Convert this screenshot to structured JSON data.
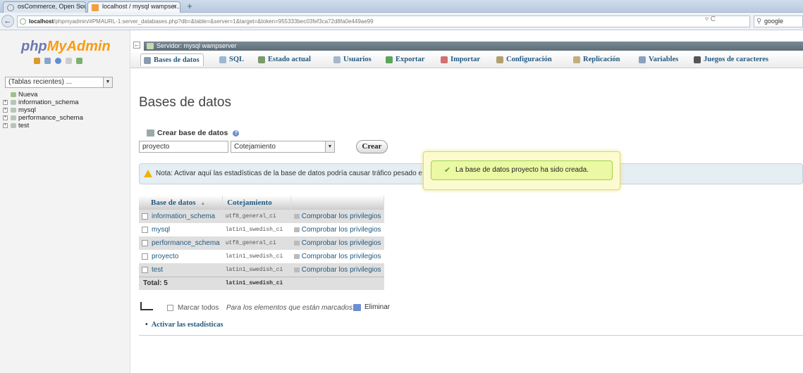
{
  "browser": {
    "tabs": [
      {
        "label": "osCommerce, Open Sourc...",
        "active": false
      },
      {
        "label": "localhost / mysql wampser...",
        "active": true
      }
    ],
    "tab_close": "×",
    "new_tab": "+",
    "url_host": "localhost",
    "url_path": "/phpmyadmin/#PMAURL-1:server_databases.php?db=&table=&server=1&target=&token=955333bec03fef3ca72d8fa0e449ae99",
    "reload": "▿ C",
    "search": "google",
    "back": "←"
  },
  "sidebar": {
    "logo_php": "php",
    "logo_myadmin": "MyAdmin",
    "recent_select": "(Tablas recientes) ...",
    "items": [
      "Nueva",
      "information_schema",
      "mysql",
      "performance_schema",
      "test"
    ]
  },
  "header": {
    "collapse": "←",
    "server_title": "Servidor: mysql wampserver"
  },
  "menu": [
    {
      "label": "Bases de datos",
      "icon_color": "#8a9bb0"
    },
    {
      "label": "SQL",
      "icon_color": "#9bb7d4"
    },
    {
      "label": "Estado actual",
      "icon_color": "#7a9a6a"
    },
    {
      "label": "Usuarios",
      "icon_color": "#a7b7c7"
    },
    {
      "label": "Exportar",
      "icon_color": "#5aa55a"
    },
    {
      "label": "Importar",
      "icon_color": "#d07070"
    },
    {
      "label": "Configuración",
      "icon_color": "#b0a070"
    },
    {
      "label": "Replicación",
      "icon_color": "#c0b080"
    },
    {
      "label": "Variables",
      "icon_color": "#8aa0c0"
    },
    {
      "label": "Juegos de caracteres",
      "icon_color": "#555555"
    }
  ],
  "main": {
    "title": "Bases de datos",
    "create_label": "Crear base de datos",
    "help": "?",
    "db_name_value": "proyecto",
    "collation_value": "Cotejamiento",
    "create_button": "Crear",
    "notice": "Nota: Activar aquí las estadísticas de la base de datos podría causar tráfico pesado e",
    "toast": "La base de datos proyecto ha sido creada.",
    "toast_check": "✔"
  },
  "table": {
    "headers": [
      "Base de datos",
      "Cotejamiento"
    ],
    "sort_indicator": "▲",
    "rows": [
      {
        "name": "information_schema",
        "collation": "utf8_general_ci",
        "action": "Comprobar los privilegios"
      },
      {
        "name": "mysql",
        "collation": "latin1_swedish_ci",
        "action": "Comprobar los privilegios"
      },
      {
        "name": "performance_schema",
        "collation": "utf8_general_ci",
        "action": "Comprobar los privilegios"
      },
      {
        "name": "proyecto",
        "collation": "latin1_swedish_ci",
        "action": "Comprobar los privilegios"
      },
      {
        "name": "test",
        "collation": "latin1_swedish_ci",
        "action": "Comprobar los privilegios"
      }
    ],
    "total_label": "Total: 5",
    "total_collation": "latin1_swedish_ci"
  },
  "bulk": {
    "mark_all": "Marcar todos",
    "with_selected": "Para los elementos que están marcados:",
    "delete": "Eliminar"
  },
  "stats_link": "Activar las estadísticas",
  "stats_bullet": "•",
  "colors": {
    "link": "#235a81",
    "logo_php": "#6c78af",
    "logo_myadmin": "#f89c0e",
    "toast_bg": "#ebf8a4",
    "notice_bg": "#e5eef3"
  }
}
